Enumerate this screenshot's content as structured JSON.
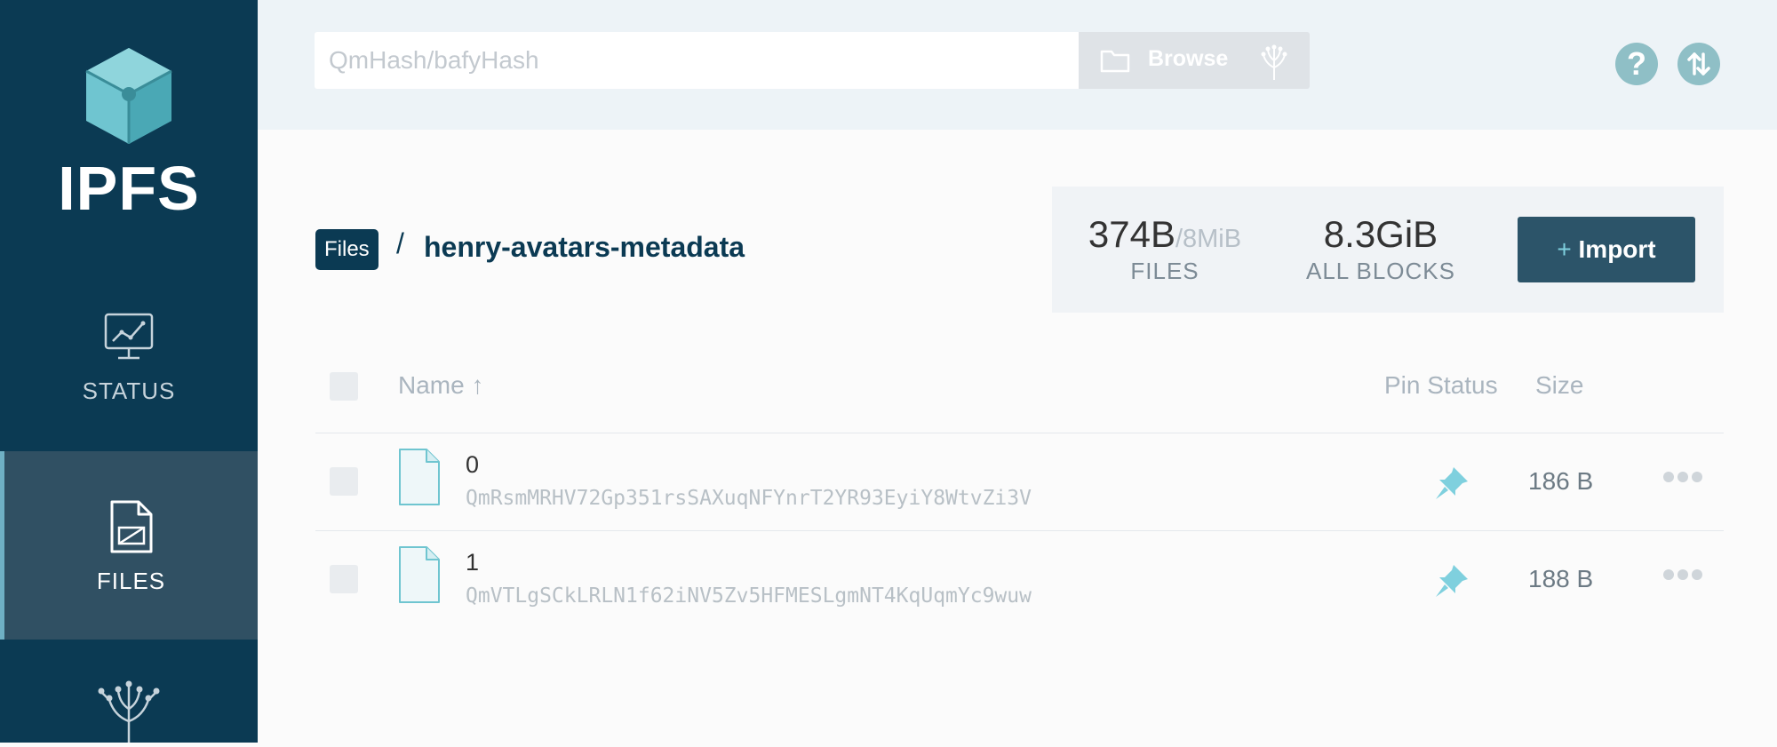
{
  "sidebar": {
    "logo_text": "IPFS",
    "items": [
      {
        "label": "STATUS",
        "icon": "status-chart-icon"
      },
      {
        "label": "FILES",
        "icon": "file-icon",
        "active": true
      },
      {
        "label": "",
        "icon": "peers-tree-icon"
      }
    ]
  },
  "header": {
    "search_placeholder": "QmHash/bafyHash",
    "browse_label": "Browse"
  },
  "breadcrumb": {
    "root": "Files",
    "separator": "/",
    "folder": "henry-avatars-metadata"
  },
  "stats": {
    "files_used": "374B",
    "files_quota": "/8MiB",
    "files_caption": "FILES",
    "blocks_value": "8.3GiB",
    "blocks_caption": "ALL BLOCKS"
  },
  "import_button": {
    "plus": "+",
    "label": "Import"
  },
  "table": {
    "headers": {
      "name": "Name ↑",
      "pin_status": "Pin Status",
      "size": "Size"
    },
    "rows": [
      {
        "name": "0",
        "cid": "QmRsmMRHV72Gp351rsSAXuqNFYnrT2YR93EyiY8WtvZi3V",
        "size": "186 B",
        "pinned": true
      },
      {
        "name": "1",
        "cid": "QmVTLgSCkLRLN1f62iNV5Zv5HFMESLgmNT4KqUqmYc9wuw",
        "size": "188 B",
        "pinned": true
      }
    ]
  },
  "colors": {
    "sidebar_bg": "#0b3a53",
    "sidebar_active": "#305063",
    "accent_teal": "#6fc5d0",
    "import_bg": "#2c5469"
  }
}
